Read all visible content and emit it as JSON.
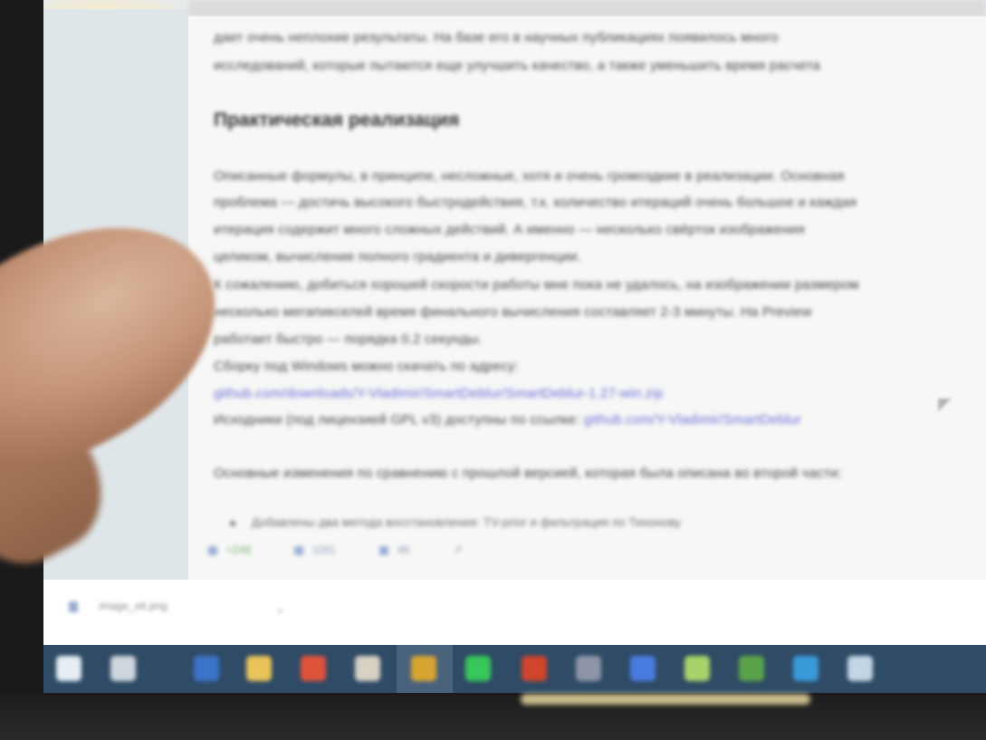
{
  "article": {
    "intro_line_1": "дает очень неплохие результаты. На базе его в научных публикациях появилось много",
    "intro_line_2": "исследований, которые пытаются еще улучшить качество, а также уменьшить время расчета",
    "heading": "Практическая реализация",
    "para_lines": [
      "Описанные формулы, в принципе, несложные, хотя и очень громоздкие в реализации. Основная",
      "проблема — достичь высокого быстродействия, т.к. количество итераций очень большое и каждая",
      "итерация содержит много сложных действий. А именно — несколько свёрток изображения",
      "целиком, вычисление полного градиента и дивергенции.",
      "К сожалению, добиться хорошей скорости работы мне пока не удалось, на изображении размером",
      "несколько мегапикселей время финального вычисления составляет 2-3 минуты. На Preview",
      "работает быстро — порядка 0.2 секунды.",
      "Сборку под Windows можно скачать по адресу:"
    ],
    "download_link": "github.com/downloads/Y-Vladimir/SmartDeblur/SmartDeblur-1.27-win.zip",
    "source_prefix": "Исходники (под лицензией GPL v3) доступны по ссылке:",
    "source_link": "github.com/Y-Vladimir/SmartDeblur",
    "changes_line": "Основные изменения по сравнению с прошлой версией, которая была описана во второй части:",
    "bullet_item": "Добавлены два метода восстановления: TV-prior и фильтрация по Тихонову",
    "stats": {
      "rating": "+248",
      "favorites": "1161",
      "comments": "46",
      "share": "↗"
    }
  },
  "download_bar": {
    "file_name": "image_xtt.png",
    "chevron": "˅"
  },
  "taskbar": {
    "icons": [
      {
        "name": "windows-start-icon",
        "color": "#e6eef6"
      },
      {
        "name": "task-view-icon",
        "color": "#cfd7df"
      },
      {
        "name": "word-icon",
        "color": "#3b74c9"
      },
      {
        "name": "file-explorer-icon",
        "color": "#e9c45a"
      },
      {
        "name": "paint-icon",
        "color": "#e0533b"
      },
      {
        "name": "app-icon",
        "color": "#d8d2c4"
      },
      {
        "name": "chrome-icon",
        "color": "#d9a531"
      },
      {
        "name": "whatsapp-icon",
        "color": "#38c75a"
      },
      {
        "name": "media-player-icon",
        "color": "#d0452c"
      },
      {
        "name": "camera-icon",
        "color": "#8e95a9"
      },
      {
        "name": "browser-icon",
        "color": "#4a7be0"
      },
      {
        "name": "notepad-icon",
        "color": "#a8d36a"
      },
      {
        "name": "photos-icon",
        "color": "#5ba34a"
      },
      {
        "name": "internet-explorer-icon",
        "color": "#3a9ad9"
      },
      {
        "name": "monitor-icon",
        "color": "#c3d6e6"
      }
    ]
  },
  "colors": {
    "taskbar": "#2f4b66",
    "link": "#6a6ed8",
    "finger": "#c69679"
  }
}
